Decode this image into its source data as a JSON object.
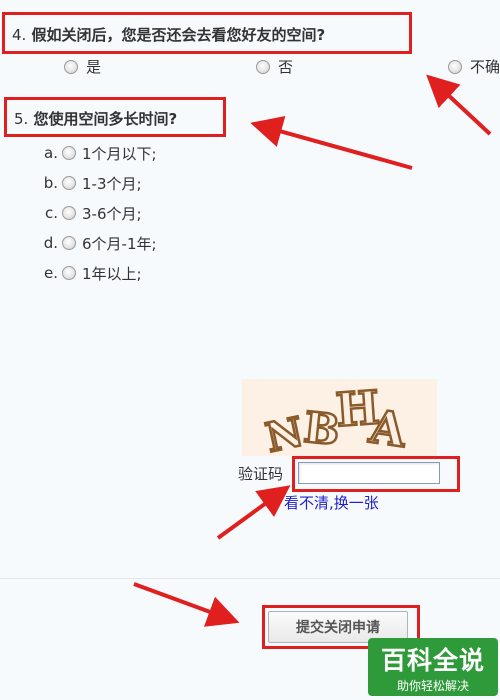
{
  "q4": {
    "number": "4.",
    "title": "假如关闭后，您是否还会去看您好友的空间?",
    "options": [
      "是",
      "否",
      "不确"
    ]
  },
  "q5": {
    "number": "5.",
    "title": "您使用空间多长时间?",
    "options": [
      {
        "marker": "a.",
        "label": "1个月以下;"
      },
      {
        "marker": "b.",
        "label": "1-3个月;"
      },
      {
        "marker": "c.",
        "label": "3-6个月;"
      },
      {
        "marker": "d.",
        "label": "6个月-1年;"
      },
      {
        "marker": "e.",
        "label": "1年以上;"
      }
    ]
  },
  "captcha": {
    "image_text": "NBHA",
    "label": "验证码",
    "input_value": "",
    "refresh_link": "看不清,换一张"
  },
  "submit_label": "提交关闭申请",
  "watermark": {
    "main": "百科全说",
    "sub": "助你轻松解决"
  },
  "colors": {
    "highlight_red": "#e01f1f",
    "link_blue": "#1f1fcc",
    "watermark_green": "#2e9a3a"
  }
}
